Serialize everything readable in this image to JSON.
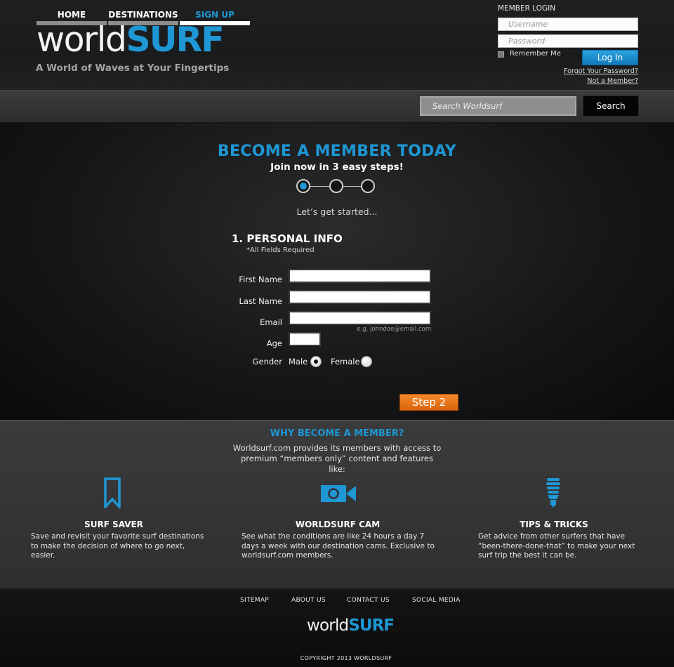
{
  "brand": {
    "name_light": "world",
    "name_bold": "SURF",
    "tagline": "A World of Waves at Your Fingertips",
    "accent_color": "#1e97d4"
  },
  "login": {
    "title": "MEMBER LOGIN",
    "username_placeholder": "Username",
    "password_placeholder": "Password",
    "remember_label": "Remember Me",
    "login_button": "Log In",
    "forgot_link": "Forgot Your Password?",
    "not_member_link": "Not a Member?"
  },
  "nav": {
    "items": [
      {
        "label": "HOME",
        "active": false
      },
      {
        "label": "DESTINATIONS",
        "active": false
      },
      {
        "label": "SIGN UP",
        "active": true
      }
    ],
    "search_placeholder": "Search Worldsurf",
    "search_button": "Search"
  },
  "signup": {
    "headline": "BECOME A MEMBER TODAY",
    "subhead": "Join now in 3 easy steps!",
    "steps": {
      "current": 1,
      "total": 3
    },
    "started_text": "Let’s get started...",
    "section_title": "1. PERSONAL INFO",
    "required_note": "*All Fields Required",
    "fields": {
      "first_name": {
        "label": "First Name",
        "value": ""
      },
      "last_name": {
        "label": "Last Name",
        "value": ""
      },
      "email": {
        "label": "Email",
        "value": "",
        "hint": "e.g. johndoe@email.com"
      },
      "age": {
        "label": "Age",
        "value": ""
      }
    },
    "gender": {
      "label": "Gender",
      "options": [
        "Male",
        "Female"
      ],
      "selected": "Male"
    },
    "next_button": "Step 2",
    "next_button_color": "#e8761a"
  },
  "why": {
    "title": "WHY BECOME A MEMBER?",
    "description": "Worldsurf.com provides its members with access to premium “members only” content and features like:",
    "features": [
      {
        "icon": "bookmark-icon",
        "title": "SURF SAVER",
        "description": "Save and revisit your favorite surf destinations to make the decision of where to go next, easier."
      },
      {
        "icon": "video-camera-icon",
        "title": "WORLDSURF CAM",
        "description": "See what the conditions are like 24 hours a day 7 days a week with our destination cams. Exclusive to worldsurf.com members."
      },
      {
        "icon": "lightbulb-icon",
        "title": "TIPS & TRICKS",
        "description": "Get advice from other surfers that have “been-there-done-that” to make your next surf trip the best it can be."
      }
    ]
  },
  "footer": {
    "links": [
      "SITEMAP",
      "ABOUT US",
      "CONTACT US",
      "SOCIAL MEDIA"
    ],
    "logo_light": "world",
    "logo_bold": "SURF",
    "copyright": "COPYRIGHT 2013 WORLDSURF"
  }
}
